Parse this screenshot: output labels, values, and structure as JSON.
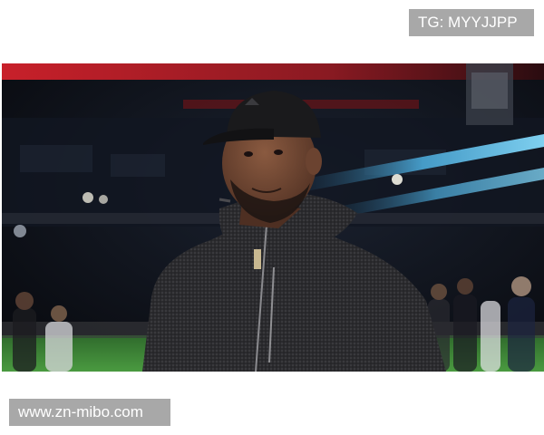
{
  "watermark_top": "TG: MYYJJPP",
  "watermark_bottom": "www.zn-mibo.com",
  "photo": {
    "subject": "man-in-black-cap-and-dark-fleece-jacket",
    "setting": "stadium-at-night",
    "colors": {
      "background": "#0b0d12",
      "stand_red": "#c8202a",
      "stand_blue": "#4aa8d8",
      "pitch_green": "#3f8a3a",
      "jacket": "#2a2a2c",
      "skin": "#6b4330",
      "cap": "#1a1a1c"
    }
  }
}
